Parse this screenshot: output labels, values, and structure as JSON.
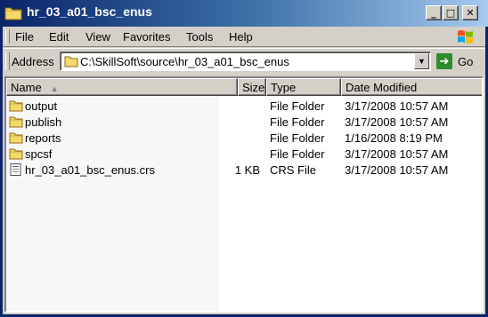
{
  "window": {
    "title": "hr_03_a01_bsc_enus",
    "controls": {
      "minimize": "_",
      "maximize": "□",
      "close": "✕"
    }
  },
  "menu": {
    "items": [
      "File",
      "Edit",
      "View",
      "Favorites",
      "Tools",
      "Help"
    ]
  },
  "address": {
    "label": "Address",
    "value": "C:\\SkillSoft\\source\\hr_03_a01_bsc_enus",
    "go_label": "Go"
  },
  "columns": {
    "name": "Name",
    "size": "Size",
    "type": "Type",
    "date": "Date Modified"
  },
  "files": [
    {
      "name": "output",
      "size": "",
      "type": "File Folder",
      "date": "3/17/2008 10:57 AM",
      "icon": "folder-icon"
    },
    {
      "name": "publish",
      "size": "",
      "type": "File Folder",
      "date": "3/17/2008 10:57 AM",
      "icon": "folder-icon"
    },
    {
      "name": "reports",
      "size": "",
      "type": "File Folder",
      "date": "1/16/2008 8:19 PM",
      "icon": "folder-icon"
    },
    {
      "name": "spcsf",
      "size": "",
      "type": "File Folder",
      "date": "3/17/2008 10:57 AM",
      "icon": "folder-icon"
    },
    {
      "name": "hr_03_a01_bsc_enus.crs",
      "size": "1 KB",
      "type": "CRS File",
      "date": "3/17/2008 10:57 AM",
      "icon": "file-icon"
    }
  ],
  "colors": {
    "title_bar_start": "#0a246a",
    "title_bar_end": "#a6caf0",
    "chrome": "#d4d0c8",
    "folder": "#f5d86a"
  }
}
